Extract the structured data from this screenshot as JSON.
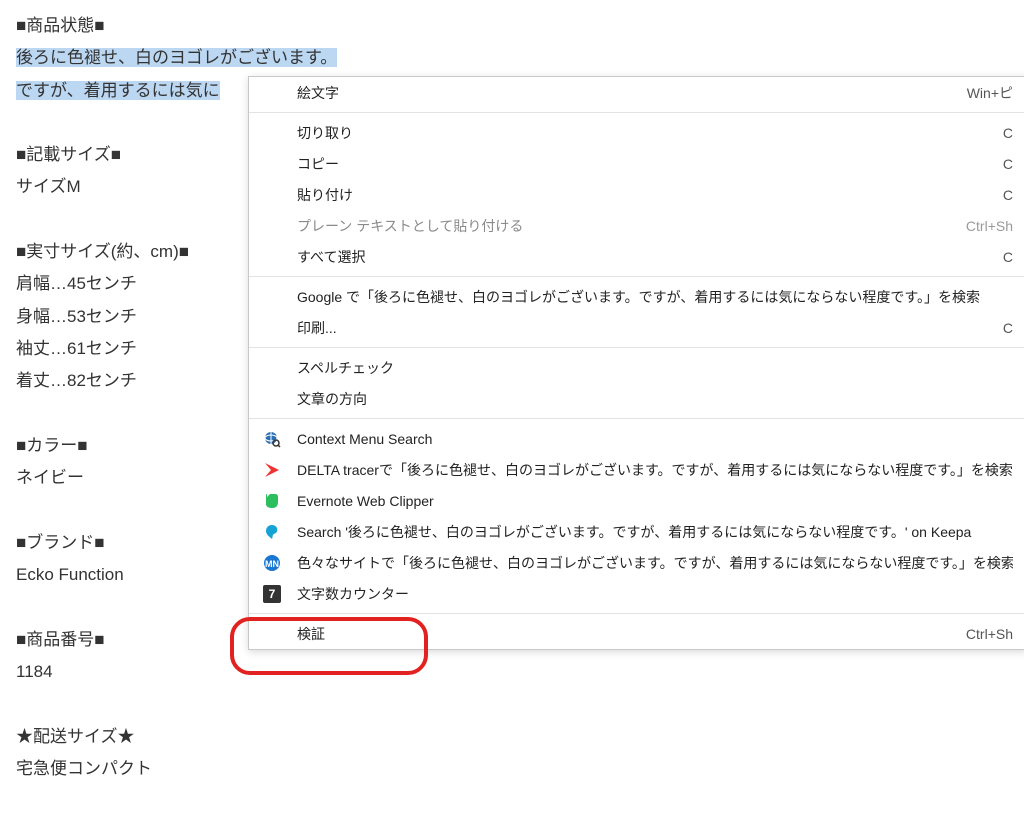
{
  "content": {
    "s1_title": "■商品状態■",
    "s1_line1": "後ろに色褪せ、白のヨゴレがございます。",
    "s1_line2a": "ですが、着用するには気に",
    "s1_line2b": "",
    "s2_title": "■記載サイズ■",
    "s2_line1": "サイズM",
    "s3_title": "■実寸サイズ(約、cm)■",
    "s3_line1": "肩幅…45センチ",
    "s3_line2": "身幅…53センチ",
    "s3_line3": "袖丈…61センチ",
    "s3_line4": "着丈…82センチ",
    "s4_title": "■カラー■",
    "s4_line1": "ネイビー",
    "s5_title": "■ブランド■",
    "s5_line1": "Ecko Function",
    "s6_title": "■商品番号■",
    "s6_line1": "1184",
    "s7_title": "★配送サイズ★",
    "s7_line1": "宅急便コンパクト"
  },
  "menu": {
    "emoji": {
      "label": "絵文字",
      "shortcut": "Win+ピ"
    },
    "cut": {
      "label": "切り取り",
      "shortcut": "C"
    },
    "copy": {
      "label": "コピー",
      "shortcut": "C"
    },
    "paste": {
      "label": "貼り付け",
      "shortcut": "C"
    },
    "paste_plain": {
      "label": "プレーン テキストとして貼り付ける",
      "shortcut": "Ctrl+Sh"
    },
    "select_all": {
      "label": "すべて選択",
      "shortcut": "C"
    },
    "google_search": {
      "label": "Google で「後ろに色褪せ、白のヨゴレがございます。ですが、着用するには気にならない程度です。」を検索"
    },
    "print": {
      "label": "印刷...",
      "shortcut": "C"
    },
    "spellcheck": {
      "label": "スペルチェック"
    },
    "direction": {
      "label": "文章の方向"
    },
    "ext_cms": {
      "label": "Context Menu Search"
    },
    "ext_delta": {
      "label": "DELTA tracerで「後ろに色褪せ、白のヨゴレがございます。ですが、着用するには気にならない程度です。」を検索"
    },
    "ext_evernote": {
      "label": "Evernote Web Clipper"
    },
    "ext_keepa": {
      "label": "Search '後ろに色褪せ、白のヨゴレがございます。ですが、着用するには気にならない程度です。' on Keepa"
    },
    "ext_sites": {
      "label": "色々なサイトで「後ろに色褪せ、白のヨゴレがございます。ですが、着用するには気にならない程度です。」を検索"
    },
    "ext_counter": {
      "label": "文字数カウンター"
    },
    "inspect": {
      "label": "検証",
      "shortcut": "Ctrl+Sh"
    }
  },
  "icons": {
    "counter_glyph": "7"
  }
}
